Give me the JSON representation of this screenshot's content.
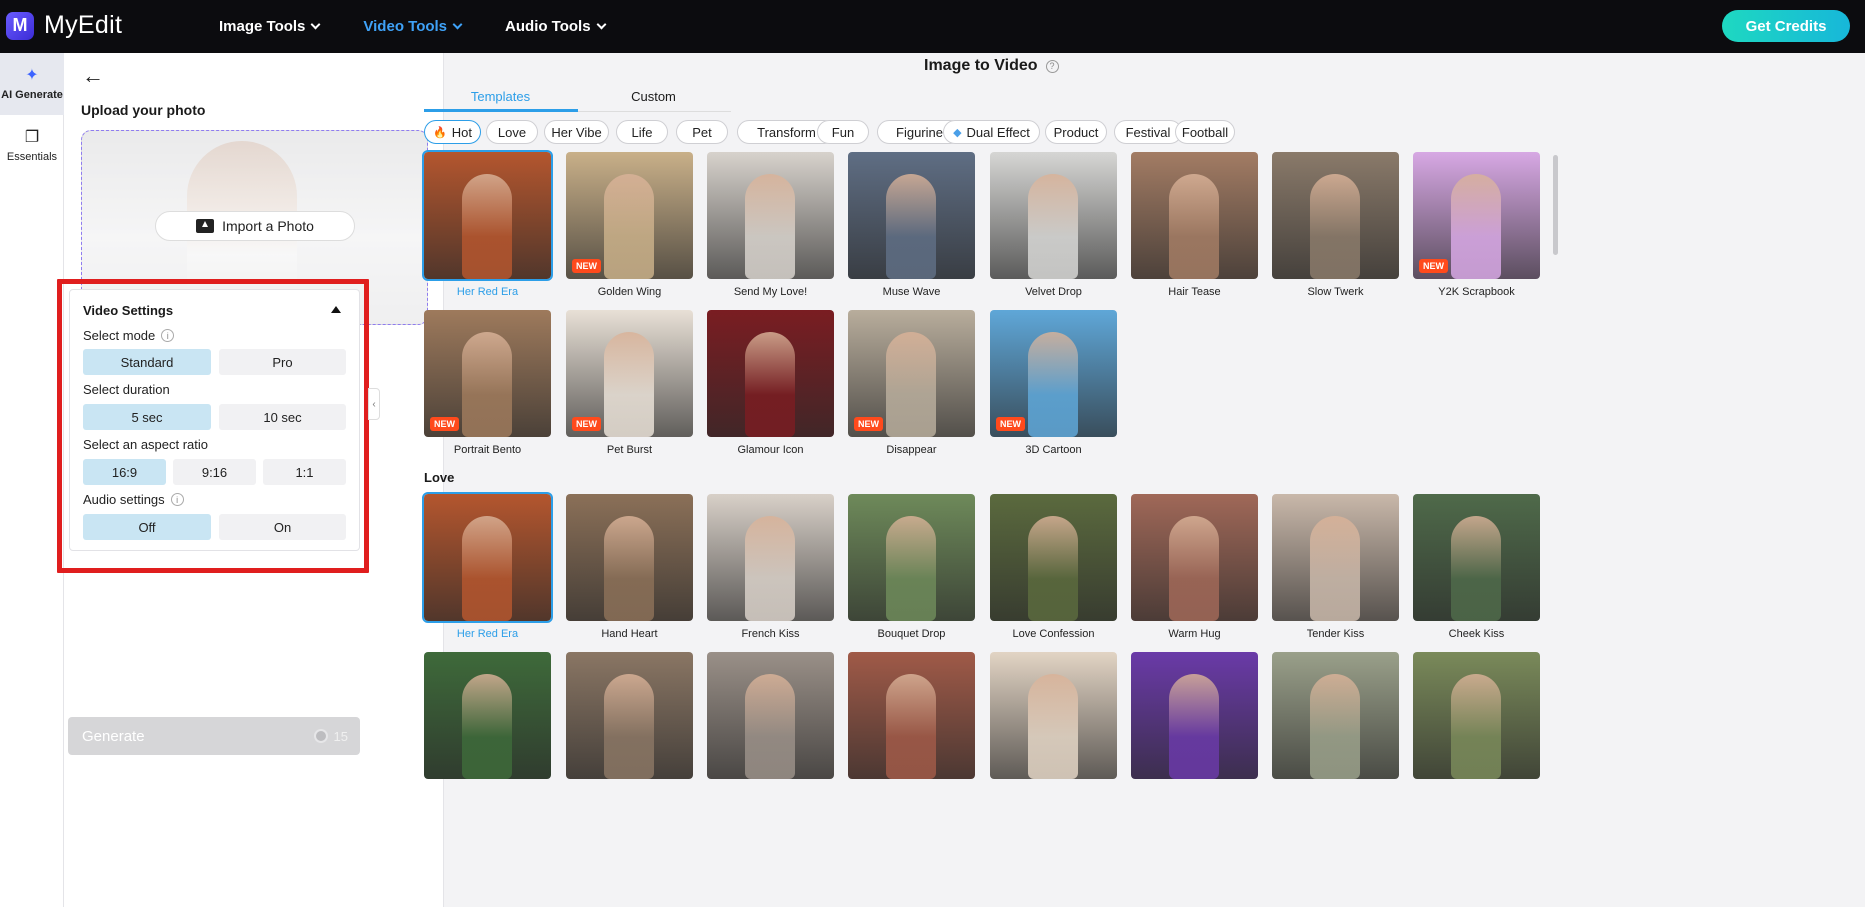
{
  "app": {
    "name": "MyEdit",
    "logo_letter": "M"
  },
  "nav": [
    {
      "label": "Image Tools",
      "active": false
    },
    {
      "label": "Video Tools",
      "active": true
    },
    {
      "label": "Audio Tools",
      "active": false
    }
  ],
  "header": {
    "cta": "Get Credits"
  },
  "rail": [
    {
      "label": "AI Generate",
      "icon": "magic-wand-icon",
      "active": true
    },
    {
      "label": "Essentials",
      "icon": "layers-icon",
      "active": false
    }
  ],
  "panel": {
    "upload_title": "Upload your photo",
    "import_label": "Import a Photo",
    "settings": {
      "title": "Video Settings",
      "mode_label": "Select mode",
      "mode_options": [
        "Standard",
        "Pro"
      ],
      "mode_selected": "Standard",
      "duration_label": "Select duration",
      "duration_options": [
        "5 sec",
        "10 sec"
      ],
      "duration_selected": "5 sec",
      "aspect_label": "Select an aspect ratio",
      "aspect_options": [
        "16:9",
        "9:16",
        "1:1"
      ],
      "aspect_selected": "16:9",
      "audio_label": "Audio settings",
      "audio_options": [
        "Off",
        "On"
      ],
      "audio_selected": "Off"
    },
    "generate_label": "Generate",
    "generate_cost": "15"
  },
  "main": {
    "title": "Image to Video",
    "tabs": [
      {
        "label": "Templates",
        "active": true
      },
      {
        "label": "Custom",
        "active": false
      }
    ],
    "chips": [
      {
        "label": "Hot",
        "icon": "fire-icon",
        "active": true
      },
      {
        "label": "Love"
      },
      {
        "label": "Her Vibe"
      },
      {
        "label": "Life"
      },
      {
        "label": "Pet"
      },
      {
        "label": "Transform"
      },
      {
        "label": "Fun"
      },
      {
        "label": "Figurine"
      },
      {
        "label": "Dual Effect",
        "icon": "diamond-icon"
      },
      {
        "label": "Product"
      },
      {
        "label": "Festival"
      },
      {
        "label": "Football"
      }
    ],
    "hot_templates": [
      {
        "label": "Her Red Era",
        "new": false,
        "selected": true,
        "color": "#b4562e"
      },
      {
        "label": "Golden Wing",
        "new": true,
        "color": "#c9b089"
      },
      {
        "label": "Send My Love!",
        "new": false,
        "color": "#d7d2cc"
      },
      {
        "label": "Muse Wave",
        "new": false,
        "color": "#5f6e84"
      },
      {
        "label": "Velvet Drop",
        "new": false,
        "color": "#d6d6d4"
      },
      {
        "label": "Hair Tease",
        "new": false,
        "color": "#a37c64"
      },
      {
        "label": "Slow Twerk",
        "new": false,
        "color": "#8a7a6a"
      },
      {
        "label": "Y2K Scrapbook",
        "new": true,
        "color": "#d7a8e4"
      },
      {
        "label": "Portrait Bento",
        "new": true,
        "color": "#9e7a5c"
      },
      {
        "label": "Pet Burst",
        "new": true,
        "color": "#e8e0d6"
      },
      {
        "label": "Glamour Icon",
        "new": false,
        "color": "#7a1d22"
      },
      {
        "label": "Disappear",
        "new": true,
        "color": "#b8ad9c"
      },
      {
        "label": "3D Cartoon",
        "new": true,
        "color": "#5fa7d8"
      }
    ],
    "love_section_title": "Love",
    "love_templates": [
      {
        "label": "Her Red Era",
        "selected": true,
        "color": "#b4562e"
      },
      {
        "label": "Hand Heart",
        "color": "#8b7058"
      },
      {
        "label": "French Kiss",
        "color": "#d8d0c8"
      },
      {
        "label": "Bouquet Drop",
        "color": "#6e8a5a"
      },
      {
        "label": "Love Confession",
        "color": "#5b6a3e"
      },
      {
        "label": "Warm Hug",
        "color": "#a06858"
      },
      {
        "label": "Tender Kiss",
        "color": "#c9b8aa"
      },
      {
        "label": "Cheek Kiss",
        "color": "#4f6a4a"
      }
    ],
    "love_row2_colors": [
      "#3e6a3a",
      "#8a7664",
      "#9a9088",
      "#a05a48",
      "#e2d4c4",
      "#6a3aa8",
      "#9aa08a",
      "#7a8a5a"
    ]
  },
  "colors": {
    "accent": "#2c9ee8",
    "nav_active": "#3fa2f7",
    "highlight": "#e01e1e",
    "selected_option": "#c9e5f3"
  }
}
